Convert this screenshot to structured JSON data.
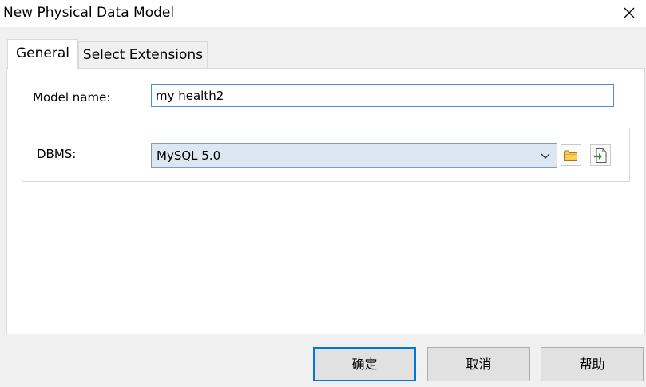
{
  "window": {
    "title": "New Physical Data Model"
  },
  "tabs": [
    {
      "label": "General",
      "active": true
    },
    {
      "label": "Select Extensions",
      "active": false
    }
  ],
  "general": {
    "model_name_label": "Model name:",
    "model_name_value": "my health2",
    "dbms_label": "DBMS:",
    "dbms_selected": "MySQL 5.0"
  },
  "buttons": {
    "ok": "确定",
    "cancel": "取消",
    "help": "帮助"
  },
  "colors": {
    "accent": "#0078d7",
    "select_bg": "#dce7f3",
    "input_border": "#4a90d9"
  },
  "icons": {
    "close": "close-icon",
    "chevron": "chevron-down-icon",
    "folder": "folder-icon",
    "import": "import-icon"
  }
}
